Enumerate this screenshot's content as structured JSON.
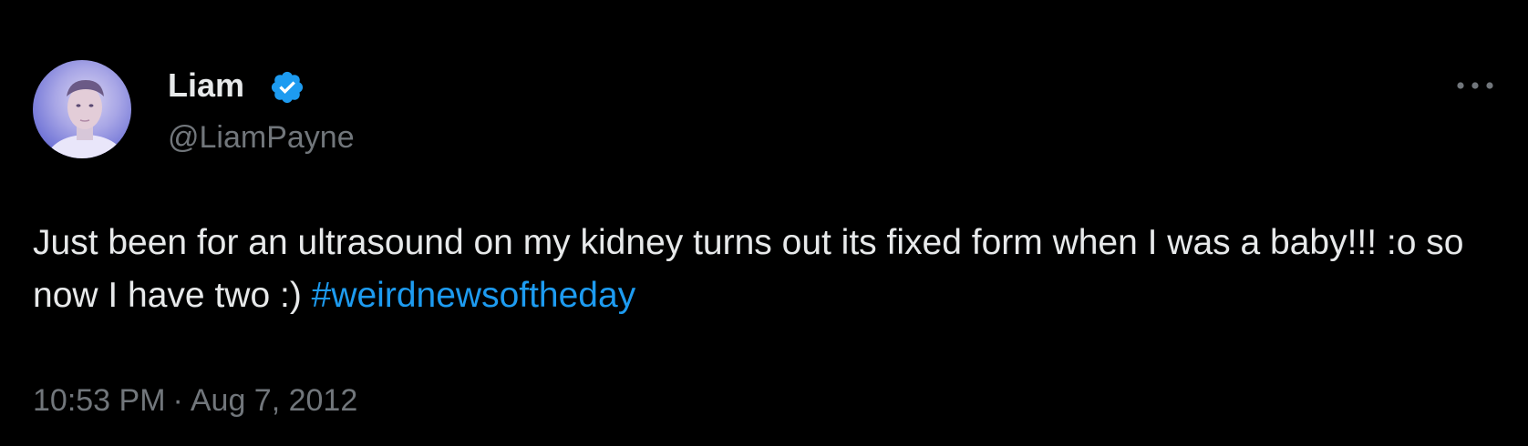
{
  "author": {
    "name": "Liam",
    "handle": "@LiamPayne",
    "verified_icon": "verified-badge-icon",
    "verified_color": "#1d9bf0"
  },
  "tweet": {
    "text": "Just been for an ultrasound on my kidney turns out its fixed form when I was a baby!!! :o so now I have two :) ",
    "hashtag": "#weirdnewsoftheday",
    "time": "10:53 PM",
    "separator": "·",
    "date": "Aug 7, 2012"
  },
  "actions": {
    "more_icon": "more-options-icon"
  },
  "colors": {
    "background": "#000000",
    "text_primary": "#e7e9ea",
    "text_secondary": "#71767b",
    "accent": "#1d9bf0"
  }
}
